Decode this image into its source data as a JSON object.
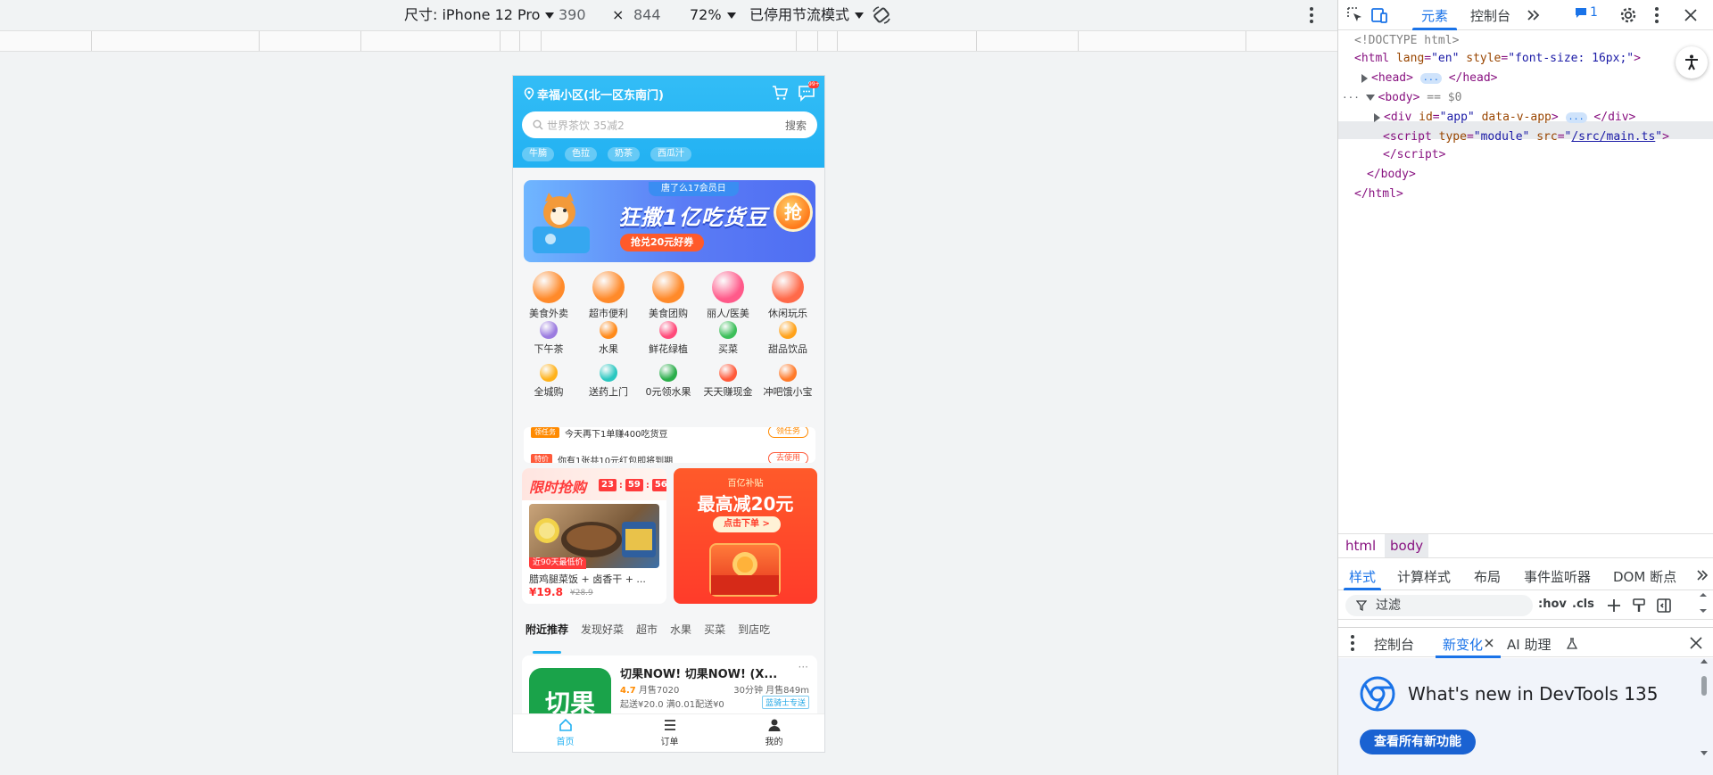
{
  "device_toolbar": {
    "dimension_label": "尺寸: iPhone 12 Pro",
    "width": "390",
    "times": "×",
    "height": "844",
    "zoom": "72%",
    "throttle": "已停用节流模式"
  },
  "app": {
    "location": "幸福小区(北一区东南门)",
    "msg_badge": "99+",
    "search": {
      "placeholder": "世界茶饮 35减2",
      "button": "搜索"
    },
    "hot_tags": [
      "牛腩",
      "色拉",
      "奶茶",
      "西瓜汁"
    ],
    "banner": {
      "subtitle": "唐了么17会员日",
      "headline": "狂撒1亿吃货豆",
      "pill": "抢兑20元好券",
      "grab": "抢"
    },
    "categories": [
      {
        "label": "美食外卖",
        "icon": "food-delivery-icon",
        "color": "#ff8a2a"
      },
      {
        "label": "超市便利",
        "icon": "supermarket-icon",
        "color": "#ff8a2a"
      },
      {
        "label": "美食团购",
        "icon": "group-buy-icon",
        "color": "#ff8a2a"
      },
      {
        "label": "丽人/医美",
        "icon": "beauty-icon",
        "color": "#ff5a8a"
      },
      {
        "label": "休闲玩乐",
        "icon": "leisure-icon",
        "color": "#ff6a4a"
      },
      {
        "label": "下午茶",
        "icon": "afternoon-tea-icon",
        "color": "#9b7be0"
      },
      {
        "label": "水果",
        "icon": "fruit-icon",
        "color": "#ff8a1a"
      },
      {
        "label": "鲜花绿植",
        "icon": "flower-icon",
        "color": "#ff4a7a"
      },
      {
        "label": "买菜",
        "icon": "vegetable-icon",
        "color": "#3cbf5a"
      },
      {
        "label": "甜品饮品",
        "icon": "dessert-icon",
        "color": "#ffa21a"
      },
      {
        "label": "全城购",
        "icon": "citywide-shopping-icon",
        "color": "#ffb21a"
      },
      {
        "label": "送药上门",
        "icon": "medicine-icon",
        "color": "#2ac7c0"
      },
      {
        "label": "0元领水果",
        "icon": "free-fruit-icon",
        "color": "#2aae4a"
      },
      {
        "label": "天天赚现金",
        "icon": "cash-icon",
        "color": "#ff5a3a"
      },
      {
        "label": "冲吧饿小宝",
        "icon": "mascot-icon",
        "color": "#ff7a2a"
      }
    ],
    "tasks": {
      "row1_badge": "领任务",
      "row1_text": "今天再下1单赚400吃货豆",
      "row1_btn": "领任务",
      "row2_badge": "特价",
      "row2_text": "你有1张共10元红包即将到期",
      "row2_btn": "去使用"
    },
    "flash_sale": {
      "title": "限时抢购",
      "hh": "23",
      "mm": "59",
      "ss": "56",
      "lowest": "近90天最低价",
      "name": "腊鸡腿菜饭 + 卤香干 + ...",
      "price": "¥19.8",
      "old_price": "¥28.9"
    },
    "subsidy": {
      "tagline": "百亿补贴",
      "headline": "最高减20元",
      "button": "点击下单 >"
    },
    "feed_tabs": [
      "附近推荐",
      "发现好菜",
      "超市",
      "水果",
      "买菜",
      "到店吃"
    ],
    "store": {
      "logo_text": "切果",
      "name": "切果NOW! 切果NOW! (X...",
      "more": "···",
      "rating": "4.7",
      "monthly": "月售7020",
      "time_dist": "30分钟  月售849m",
      "delivery": "起送¥20.0  满0.01配送¥0",
      "tag": "蓝骑士专送"
    },
    "tabbar": [
      "首页",
      "订单",
      "我的"
    ]
  },
  "devtools": {
    "tabs": {
      "elements": "元素",
      "console": "控制台",
      "issues_count": "1"
    },
    "dom": {
      "doctype": "<!DOCTYPE html>",
      "html_open_tag": "html",
      "html_attr1": "lang",
      "html_val1": "\"en\"",
      "html_attr2": "style",
      "html_val2": "\"font-size: 16px;\"",
      "head": "head",
      "body": "body",
      "body_marker": "== $0",
      "div_id": "\"app\"",
      "div_attr": "data-v-app",
      "script_type": "\"module\"",
      "script_src": "/src/main.ts",
      "ellipsis": "..."
    },
    "breadcrumbs": [
      "html",
      "body"
    ],
    "style_tabs": [
      "样式",
      "计算样式",
      "布局",
      "事件监听器",
      "DOM 断点"
    ],
    "filter": {
      "placeholder": "过滤",
      "hov": ":hov",
      "cls": ".cls"
    },
    "drawer_tabs": [
      "控制台",
      "新变化",
      "AI 助理"
    ],
    "whats_new": {
      "title": "What's new in DevTools 135",
      "button": "查看所有新功能"
    }
  }
}
